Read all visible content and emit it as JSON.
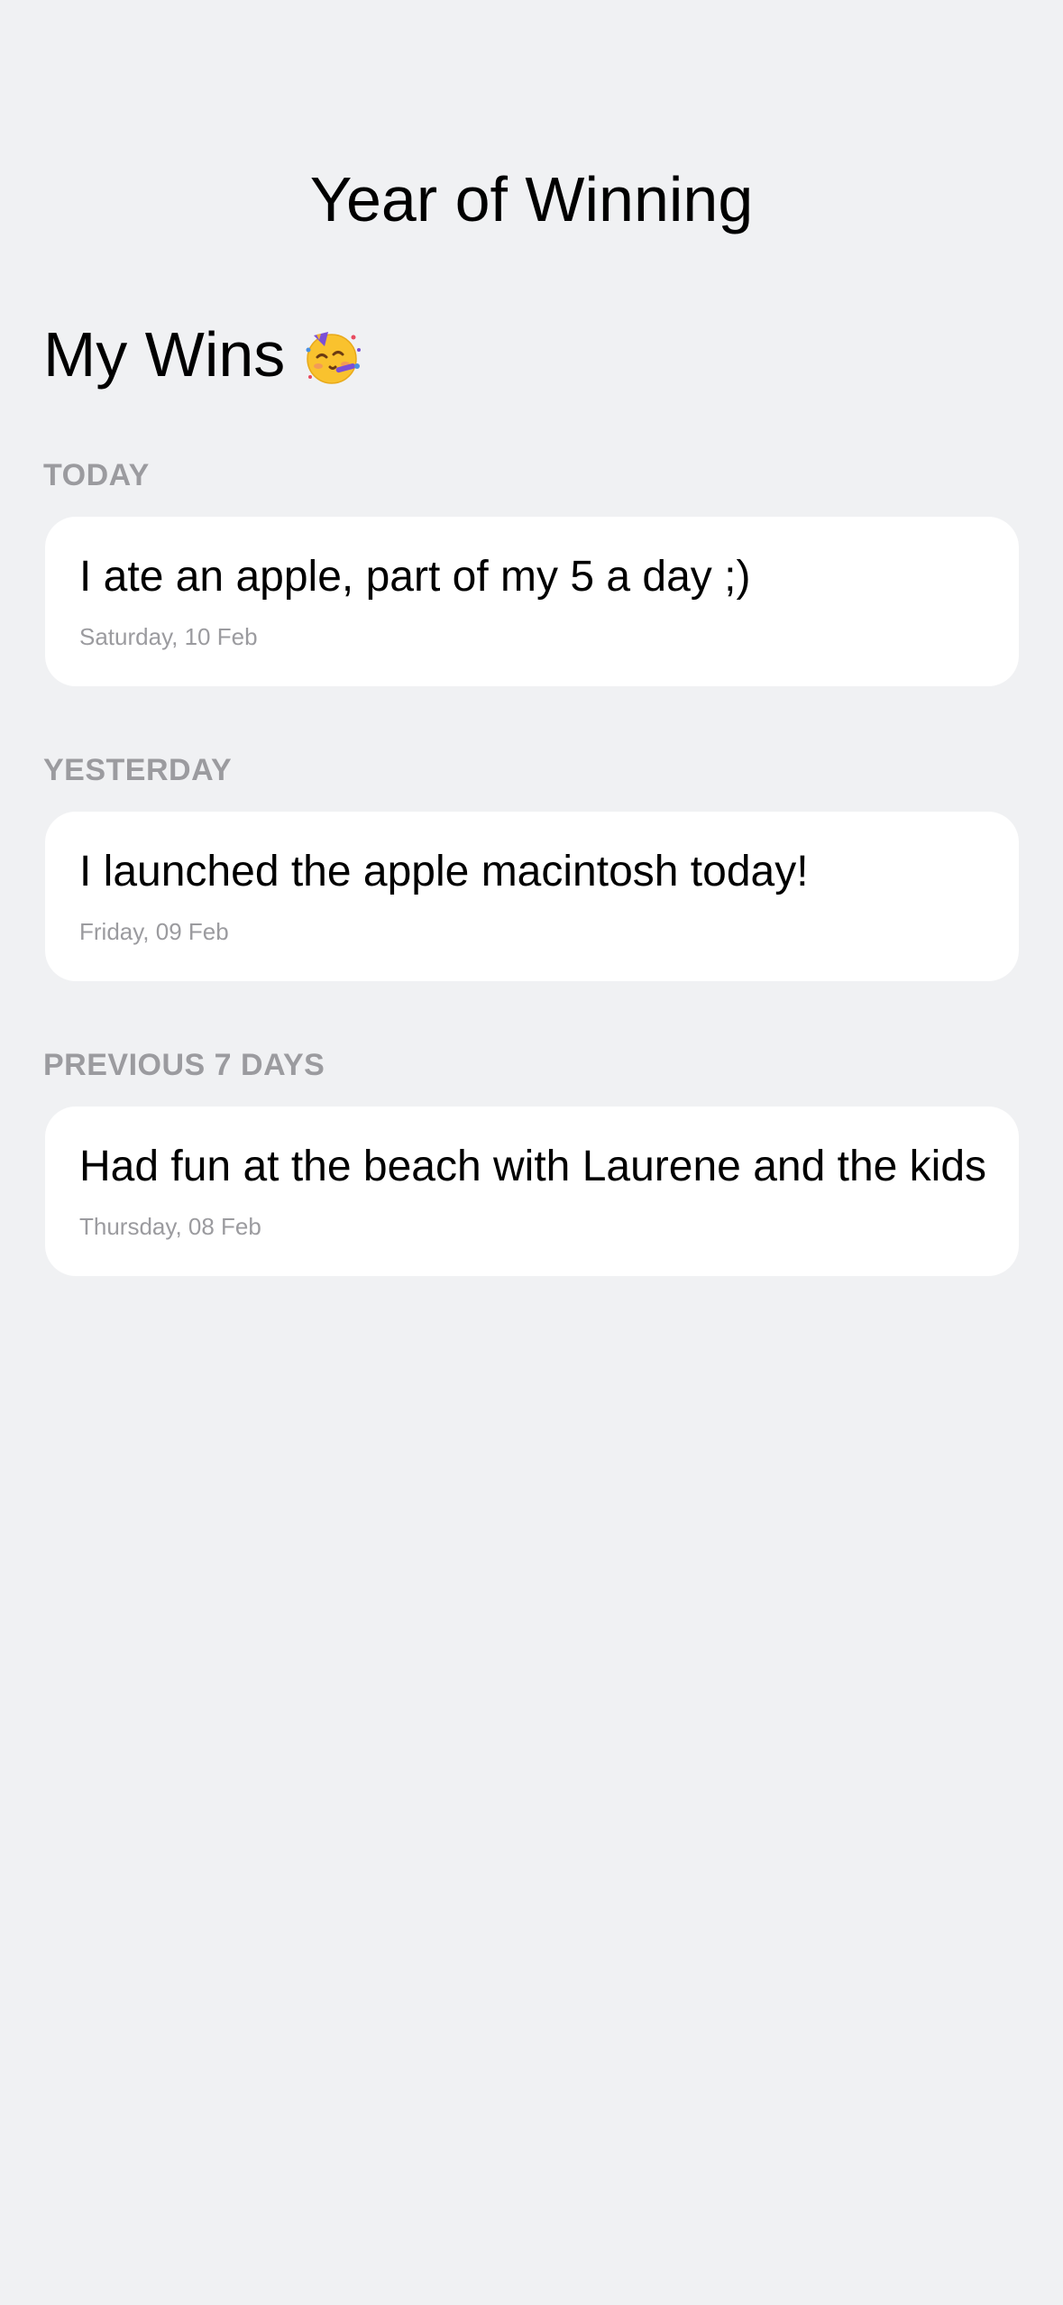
{
  "header": {
    "title": "Year of Winning"
  },
  "page": {
    "heading": "My Wins",
    "heading_icon": "partying-face-icon"
  },
  "sections": [
    {
      "label": "TODAY",
      "entries": [
        {
          "title": "I ate an apple, part of my 5 a day ;)",
          "date": "Saturday, 10 Feb"
        }
      ]
    },
    {
      "label": "YESTERDAY",
      "entries": [
        {
          "title": "I launched the apple macintosh today!",
          "date": "Friday, 09 Feb"
        }
      ]
    },
    {
      "label": "PREVIOUS 7 DAYS",
      "entries": [
        {
          "title": "Had fun at the beach with Laurene and the kids",
          "date": "Thursday, 08 Feb"
        }
      ]
    }
  ],
  "colors": {
    "background": "#f0f1f3",
    "card": "#ffffff",
    "secondary_text": "#9b9b9f",
    "primary_text": "#000000"
  }
}
